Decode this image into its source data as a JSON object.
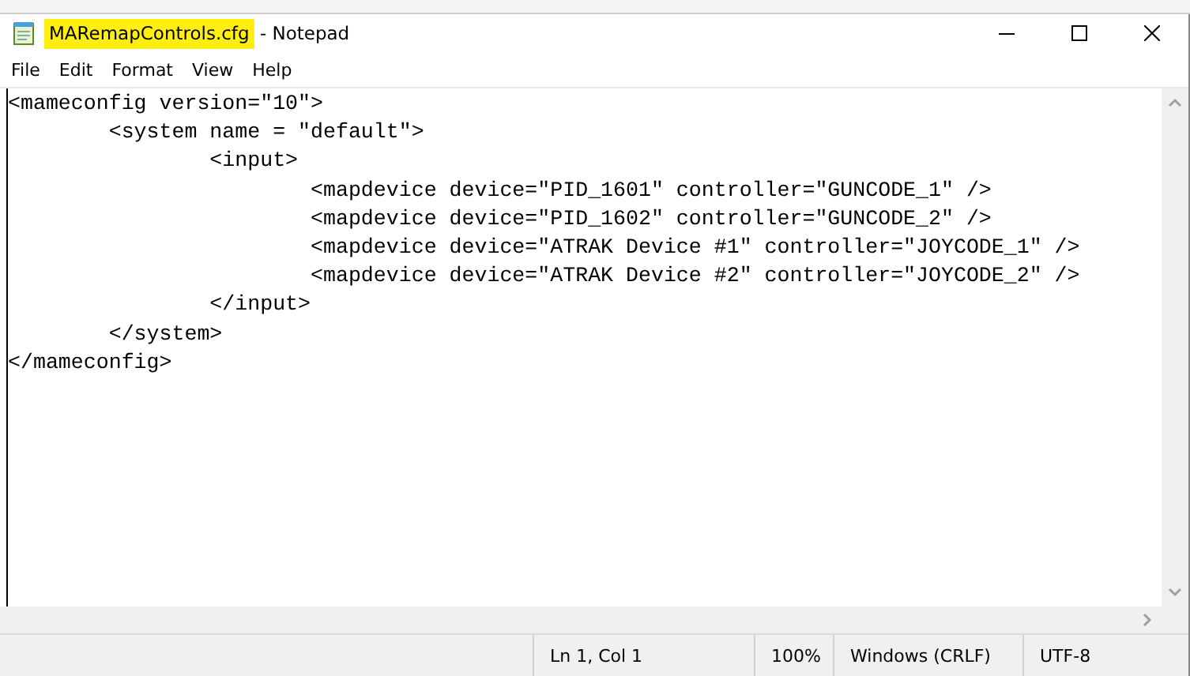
{
  "window": {
    "filename": "MARemapControls.cfg",
    "filename_highlighted": true,
    "app": "- Notepad"
  },
  "menu": [
    "File",
    "Edit",
    "Format",
    "View",
    "Help"
  ],
  "editor": {
    "lines": [
      "<mameconfig version=\"10\">",
      "\t<system name = \"default\">",
      "\t\t<input>",
      "\t\t\t<mapdevice device=\"PID_1601\" controller=\"GUNCODE_1\" />",
      "\t\t\t<mapdevice device=\"PID_1602\" controller=\"GUNCODE_2\" />",
      "\t\t\t<mapdevice device=\"ATRAK Device #1\" controller=\"JOYCODE_1\" />",
      "\t\t\t<mapdevice device=\"ATRAK Device #2\" controller=\"JOYCODE_2\" />",
      "\t\t</input>",
      "\t</system>",
      "</mameconfig>"
    ]
  },
  "status_bar": [
    "Ln 1, Col 1",
    "100%",
    "Windows (CRLF)",
    "UTF-8"
  ]
}
